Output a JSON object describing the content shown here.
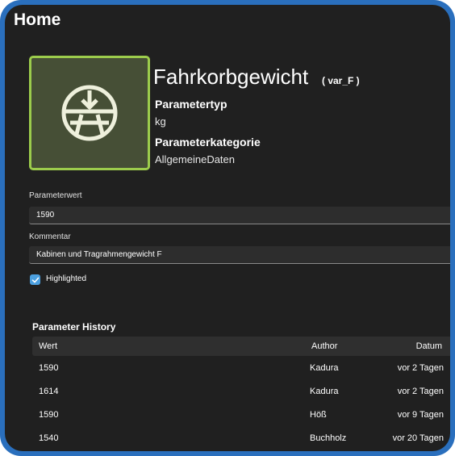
{
  "page": {
    "title": "Home"
  },
  "parameter": {
    "name": "Fahrkorbgewicht",
    "variable": "( var_F )",
    "icon": "weight-scale-icon",
    "type_label": "Parametertyp",
    "type_value": "kg",
    "category_label": "Parameterkategorie",
    "category_value": "AllgemeineDaten"
  },
  "form": {
    "value_label": "Parameterwert",
    "value": "1590",
    "comment_label": "Kommentar",
    "comment": "Kabinen und Tragrahmengewicht F",
    "highlighted_label": "Highlighted",
    "highlighted_checked": true
  },
  "history": {
    "title": "Parameter History",
    "columns": [
      "Wert",
      "Author",
      "Datum"
    ],
    "rows": [
      [
        "1590",
        "Kadura",
        "vor 2 Tagen"
      ],
      [
        "1614",
        "Kadura",
        "vor 2 Tagen"
      ],
      [
        "1590",
        "Höß",
        "vor 9 Tagen"
      ],
      [
        "1540",
        "Buchholz",
        "vor 20 Tagen"
      ]
    ]
  },
  "colors": {
    "frame": "#2a6fbd",
    "background": "#202020",
    "tile_border": "#9ccc4c",
    "tile_fill": "#464f36",
    "accent": "#4ca0e0"
  }
}
